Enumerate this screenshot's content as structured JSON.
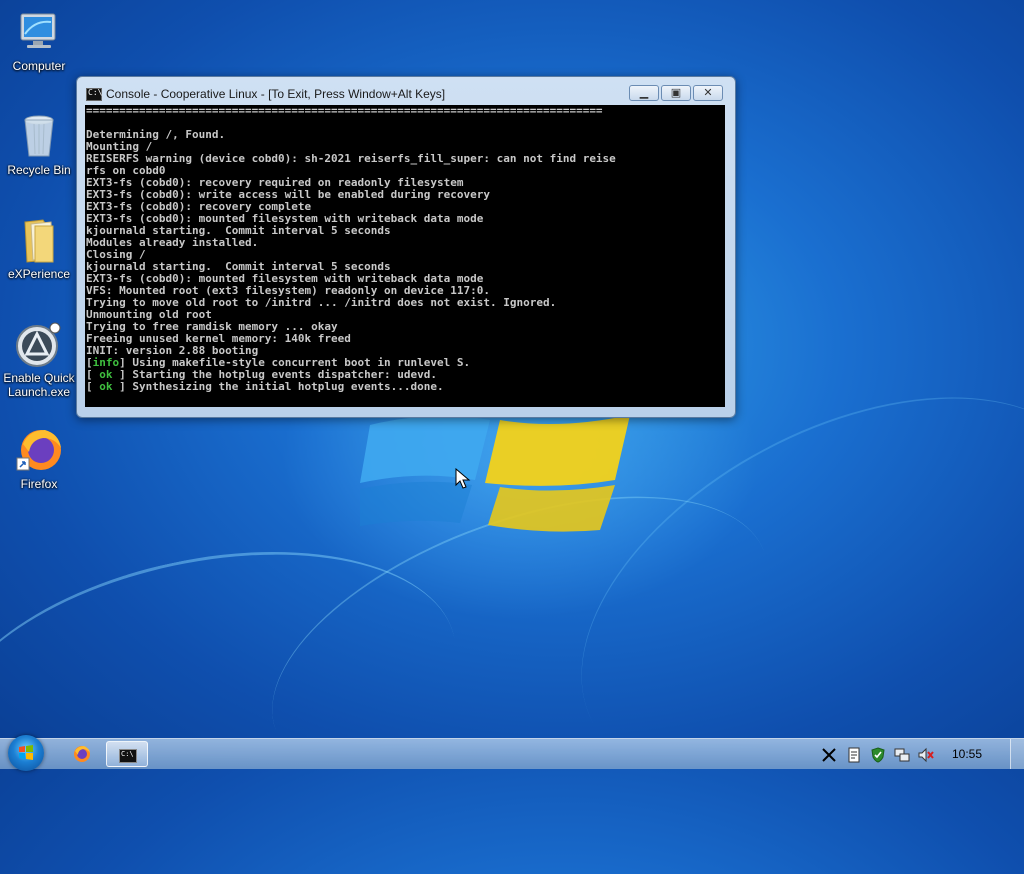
{
  "desktop": {
    "icons": [
      {
        "label": "Computer"
      },
      {
        "label": "Recycle Bin"
      },
      {
        "label": "eXPerience"
      },
      {
        "label": "Enable Quick Launch.exe"
      },
      {
        "label": "Firefox"
      }
    ]
  },
  "window": {
    "title": "Console - Cooperative Linux - [To Exit, Press Window+Alt Keys]",
    "icon_label": "C:\\",
    "buttons": {
      "minimize": "minimize-icon",
      "maximize": "maximize-icon",
      "close": "close-icon"
    }
  },
  "console": {
    "lines": [
      "==============================================================================",
      "",
      "Determining /, Found.",
      "Mounting /",
      "REISERFS warning (device cobd0): sh-2021 reiserfs_fill_super: can not find reise",
      "rfs on cobd0",
      "EXT3-fs (cobd0): recovery required on readonly filesystem",
      "EXT3-fs (cobd0): write access will be enabled during recovery",
      "EXT3-fs (cobd0): recovery complete",
      "EXT3-fs (cobd0): mounted filesystem with writeback data mode",
      "kjournald starting.  Commit interval 5 seconds",
      "Modules already installed.",
      "Closing /",
      "kjournald starting.  Commit interval 5 seconds",
      "EXT3-fs (cobd0): mounted filesystem with writeback data mode",
      "VFS: Mounted root (ext3 filesystem) readonly on device 117:0.",
      "Trying to move old root to /initrd ... /initrd does not exist. Ignored.",
      "Unmounting old root",
      "Trying to free ramdisk memory ... okay",
      "Freeing unused kernel memory: 140k freed",
      "INIT: version 2.88 booting"
    ],
    "status_lines": [
      {
        "open": "[",
        "tag": "info",
        "close": "]",
        "text": " Using makefile-style concurrent boot in runlevel S."
      },
      {
        "open": "[",
        "tag": " ok ",
        "close": "]",
        "text": " Starting the hotplug events dispatcher: udevd."
      },
      {
        "open": "[",
        "tag": " ok ",
        "close": "]",
        "text": " Synthesizing the initial hotplug events...done."
      }
    ]
  },
  "taskbar": {
    "clock": "10:55",
    "console_icon_label": "C:\\",
    "tray_icons": [
      "x-icon",
      "clipboard-icon",
      "shield-check-icon",
      "network-icon",
      "volume-muted-icon"
    ]
  },
  "colors": {
    "console_bg": "#000000",
    "console_text": "#c8c8c8",
    "status_tag": "#3fbf3f",
    "wallpaper_accent": "#1a6fd0"
  }
}
